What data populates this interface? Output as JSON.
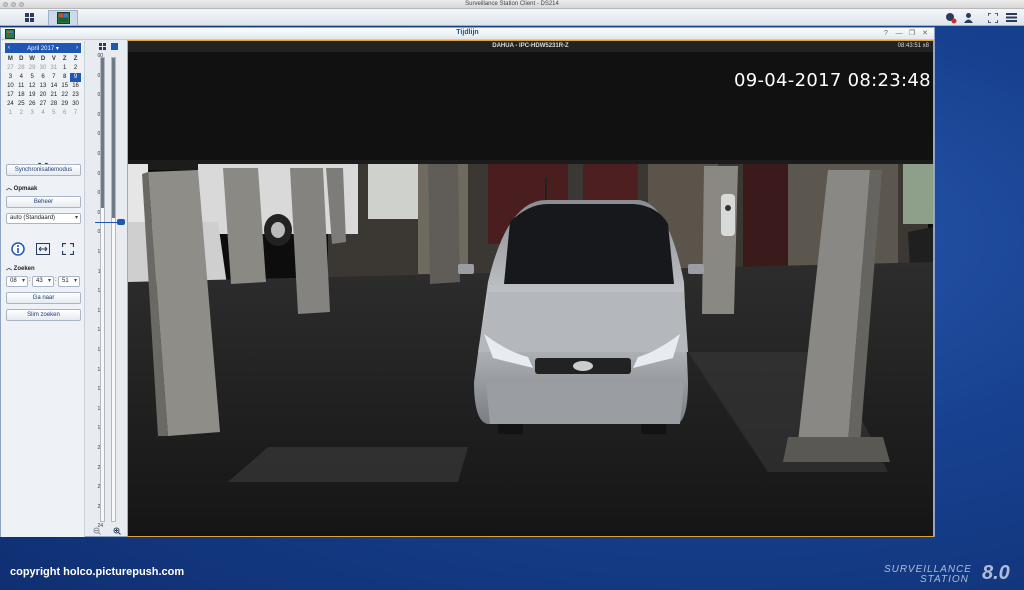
{
  "app": {
    "window_title": "Surveillance Station Client - DS214"
  },
  "window": {
    "title": "Tijdlijn",
    "controls": [
      "?",
      "—",
      "❐",
      "✕"
    ]
  },
  "calendar": {
    "month_label": "April 2017 ▾",
    "weekdays": [
      "M",
      "D",
      "W",
      "D",
      "V",
      "Z",
      "Z"
    ],
    "weeks": [
      [
        "27",
        "28",
        "29",
        "30",
        "31",
        "1",
        "2"
      ],
      [
        "3",
        "4",
        "5",
        "6",
        "7",
        "8",
        "9"
      ],
      [
        "10",
        "11",
        "12",
        "13",
        "14",
        "15",
        "16"
      ],
      [
        "17",
        "18",
        "19",
        "20",
        "21",
        "22",
        "23"
      ],
      [
        "24",
        "25",
        "26",
        "27",
        "28",
        "29",
        "30"
      ],
      [
        "1",
        "2",
        "3",
        "4",
        "5",
        "6",
        "7"
      ]
    ],
    "selected_day": "9"
  },
  "controls": {
    "sync_mode": "Synchronisatiemodus",
    "layout_section": "Opmaak",
    "manage_button": "Beheer",
    "layout_select": "auto (Standaard)",
    "search_section": "Zoeken",
    "hour": "08",
    "minute": "43",
    "second": "51",
    "goto_button": "Ga naar",
    "smart_search_button": "Slim zoeken"
  },
  "timeline": {
    "hours": [
      "00",
      "01",
      "02",
      "03",
      "04",
      "05",
      "06",
      "07",
      "08",
      "09",
      "10",
      "11",
      "12",
      "13",
      "14",
      "15",
      "16",
      "17",
      "18",
      "19",
      "20",
      "21",
      "22",
      "23",
      "24"
    ],
    "current_hour": "09"
  },
  "camera": {
    "name": "DAHUA - IPC-HDW5231R-Z",
    "clock": "08:43:51 x8",
    "osd_timestamp": "09-04-2017 08:23:48"
  },
  "footer": {
    "copyright": "copyright holco.picturepush.com",
    "brand_line1": "SURVEILLANCE",
    "brand_line2": "STATION",
    "brand_version": "8.0"
  },
  "colors": {
    "accent": "#1f57b4",
    "frame_border": "#e2a23a",
    "desktop": "#17418f"
  }
}
